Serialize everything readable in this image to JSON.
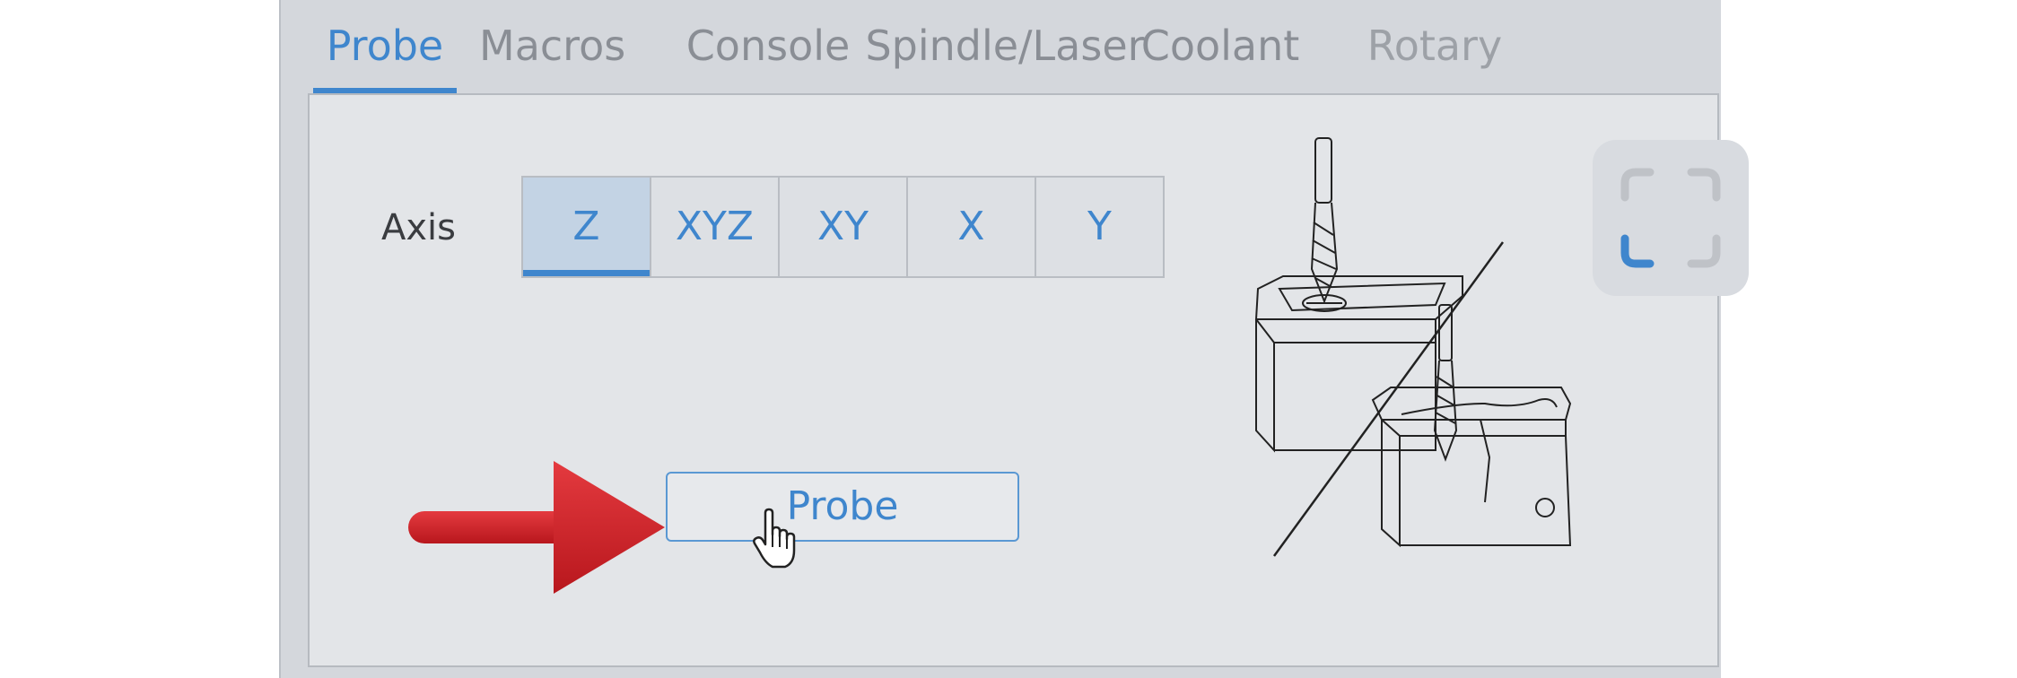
{
  "tabs": [
    {
      "label": "Probe",
      "active": true
    },
    {
      "label": "Macros",
      "active": false
    },
    {
      "label": "Console",
      "active": false
    },
    {
      "label": "Spindle/Laser",
      "active": false
    },
    {
      "label": "Coolant",
      "active": false
    },
    {
      "label": "Rotary",
      "active": false
    }
  ],
  "probe": {
    "axis_label": "Axis",
    "axis_options": [
      "Z",
      "XYZ",
      "XY",
      "X",
      "Y"
    ],
    "selected_axis": "Z",
    "probe_button_label": "Probe"
  },
  "annotation": {
    "arrow_color": "#d9242b"
  },
  "colors": {
    "accent": "#3f86cd",
    "selected_bg": "#c3d3e4"
  },
  "icons": [
    "hand-pointer-icon",
    "fullscreen-icon",
    "probing-illustration"
  ]
}
